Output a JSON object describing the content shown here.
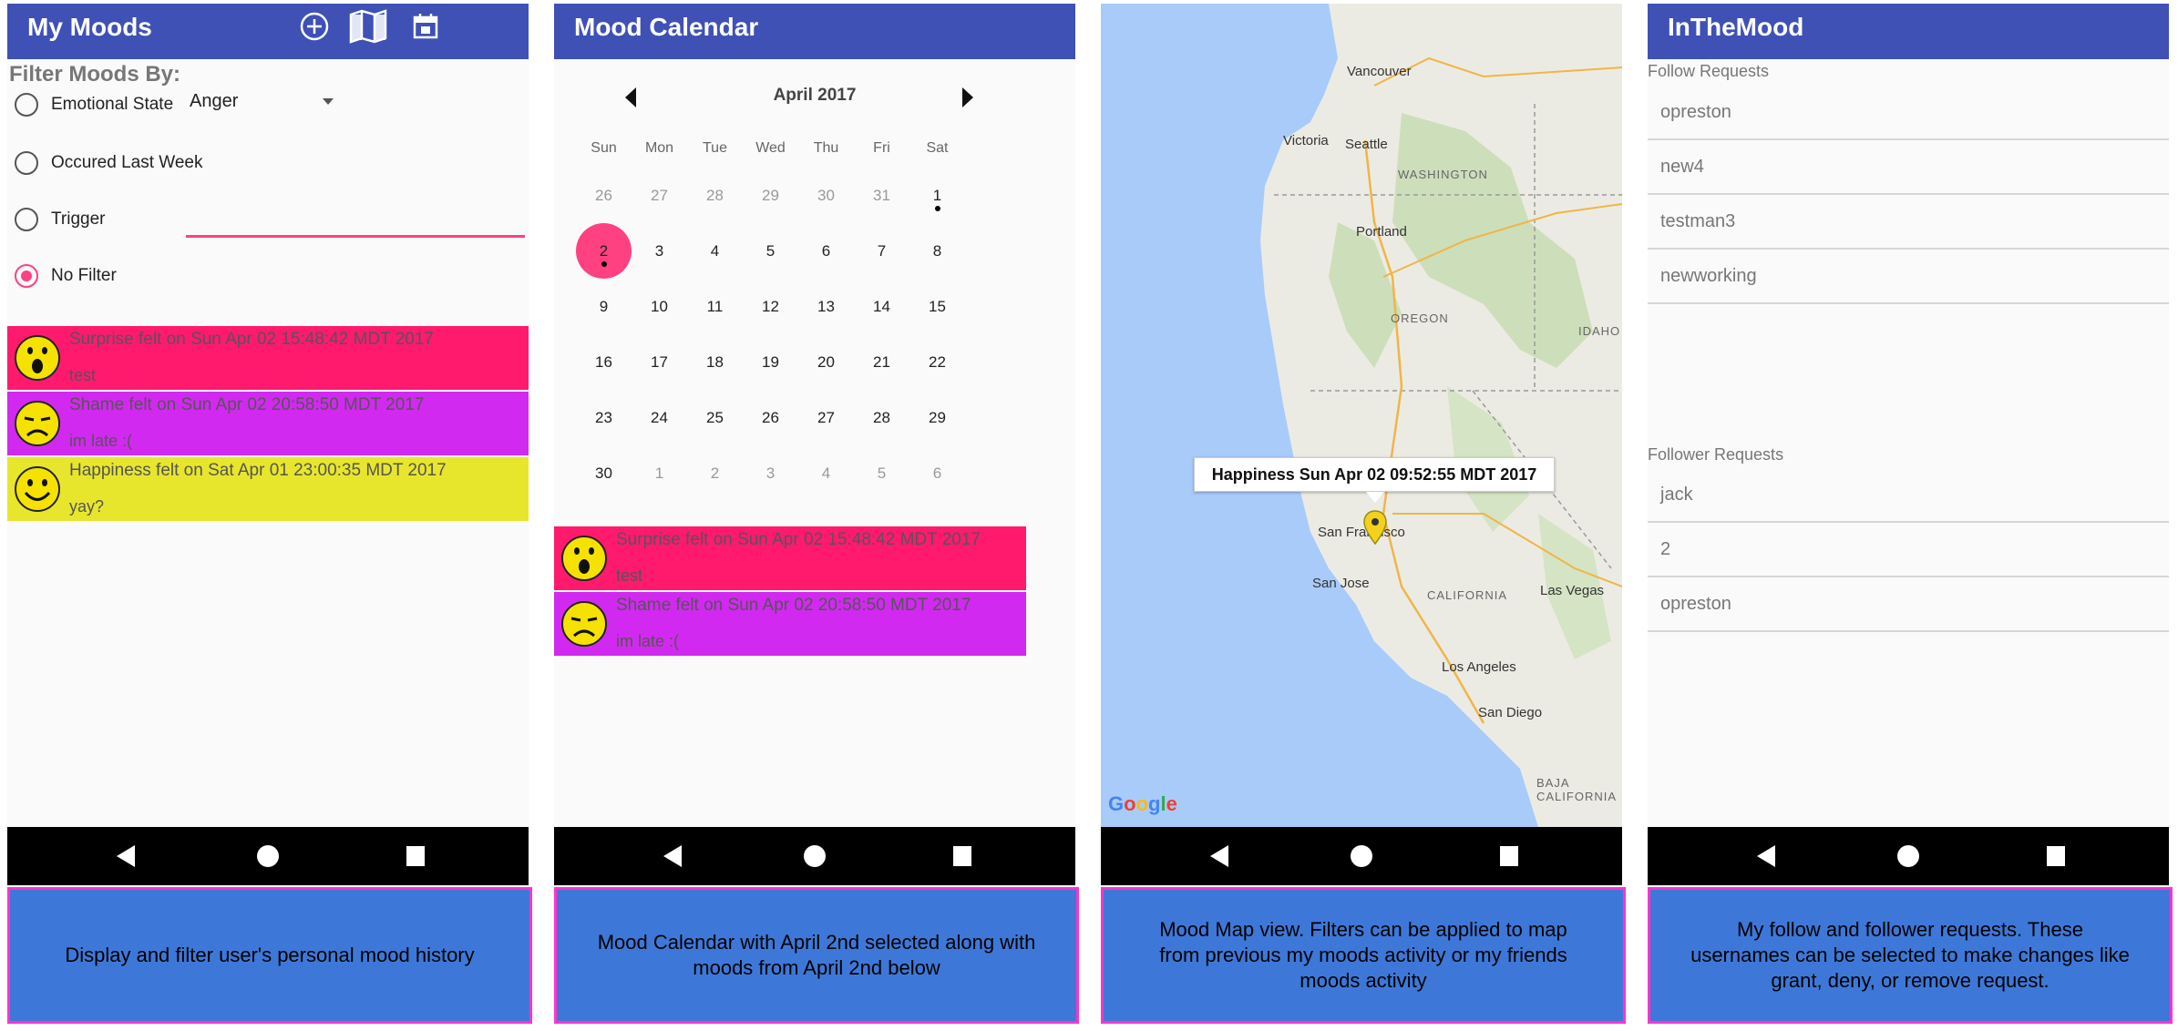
{
  "panel1": {
    "title": "My Moods",
    "filter_heading": "Filter Moods By:",
    "options": [
      {
        "label": "Emotional State",
        "selected": false
      },
      {
        "label": "Occured Last Week",
        "selected": false
      },
      {
        "label": "Trigger",
        "selected": false
      },
      {
        "label": "No Filter",
        "selected": true
      }
    ],
    "emotional_state_value": "Anger",
    "moods": [
      {
        "title": "Surprise felt on Sun Apr 02 15:48:42 MDT 2017",
        "text": "test"
      },
      {
        "title": "Shame felt on Sun Apr 02 20:58:50 MDT 2017",
        "text": "im late :("
      },
      {
        "title": "Happiness felt on Sat Apr 01 23:00:35 MDT 2017",
        "text": "yay?"
      }
    ],
    "caption": "Display and filter user's personal mood history"
  },
  "panel2": {
    "title": "Mood Calendar",
    "month": "April 2017",
    "weekdays": [
      "Sun",
      "Mon",
      "Tue",
      "Wed",
      "Thu",
      "Fri",
      "Sat"
    ],
    "weeks": [
      [
        "26",
        "27",
        "28",
        "29",
        "30",
        "31",
        "1"
      ],
      [
        "2",
        "3",
        "4",
        "5",
        "6",
        "7",
        "8"
      ],
      [
        "9",
        "10",
        "11",
        "12",
        "13",
        "14",
        "15"
      ],
      [
        "16",
        "17",
        "18",
        "19",
        "20",
        "21",
        "22"
      ],
      [
        "23",
        "24",
        "25",
        "26",
        "27",
        "28",
        "29"
      ],
      [
        "30",
        "1",
        "2",
        "3",
        "4",
        "5",
        "6"
      ]
    ],
    "selected_day": "2",
    "moods": [
      {
        "title": "Surprise felt on Sun Apr 02 15:48:42 MDT 2017",
        "text": "test"
      },
      {
        "title": "Shame felt on Sun Apr 02 20:58:50 MDT 2017",
        "text": "im late :("
      }
    ],
    "caption": "Mood Calendar with April 2nd selected along with moods from April 2nd below"
  },
  "panel3": {
    "cities": [
      "Vancouver",
      "Victoria",
      "Seattle",
      "Portland",
      "San Francisco",
      "San Jose",
      "Los Angeles",
      "San Diego",
      "Las Vegas"
    ],
    "states": [
      "WASHINGTON",
      "OREGON",
      "IDAHO",
      "CALIFORNIA",
      "BAJA CALIFORNIA"
    ],
    "marker_label": "Happiness Sun Apr 02 09:52:55 MDT 2017",
    "logo": "Google",
    "caption": "Mood Map view. Filters can be applied to map from previous my moods activity or my friends moods activity"
  },
  "panel4": {
    "title": "InTheMood",
    "follow_heading": "Follow Requests",
    "follow_requests": [
      "opreston",
      "new4",
      "testman3",
      "newworking"
    ],
    "follower_heading": "Follower Requests",
    "follower_requests": [
      "jack",
      "2",
      "opreston"
    ],
    "caption": "My follow and follower requests. These usernames can be selected to make changes like grant, deny, or remove request."
  },
  "colors": {
    "appbar": "#3f51b5",
    "accent": "#ff4081",
    "surprise": "#ff1a6e",
    "shame": "#d229f0",
    "happiness": "#e8e62c",
    "caption_bg": "#3d78d8",
    "caption_border": "#ff33cc"
  },
  "icons": [
    "add-circle-icon",
    "map-icon",
    "calendar-icon",
    "surprise-face-icon",
    "shame-face-icon",
    "happiness-face-icon",
    "map-pin-icon",
    "back-icon",
    "home-icon",
    "recents-icon"
  ]
}
